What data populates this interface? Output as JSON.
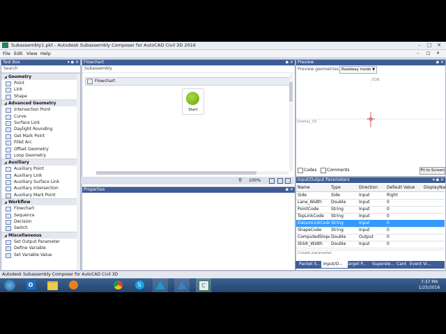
{
  "window": {
    "title": "Subassembly1.pkt - Autodesk Subassembly Composer for AutoCAD Civil 3D 2016"
  },
  "menu": [
    "File",
    "Edit",
    "View",
    "Help"
  ],
  "toolbox": {
    "title": "Tool Box",
    "search_placeholder": "Search",
    "categories": [
      {
        "name": "Geometry",
        "items": [
          "Point",
          "Link",
          "Shape"
        ]
      },
      {
        "name": "Advanced Geometry",
        "items": [
          "Intersection Point",
          "Curve",
          "Surface Link",
          "Daylight Rounding",
          "Get Mark Point",
          "Fillet Arc",
          "Offset Geometry",
          "Loop Geometry"
        ]
      },
      {
        "name": "Auxiliary",
        "items": [
          "Auxiliary Point",
          "Auxiliary Link",
          "Auxiliary Surface Link",
          "Auxiliary Intersection",
          "Auxiliary Mark Point"
        ]
      },
      {
        "name": "Workflow",
        "items": [
          "Flowchart",
          "Sequence",
          "Decision",
          "Switch"
        ]
      },
      {
        "name": "Miscellaneous",
        "items": [
          "Set Output Parameter",
          "Define Variable",
          "Set Variable Value"
        ]
      }
    ]
  },
  "flowchart": {
    "panel_title": "Flowchart",
    "breadcrumb": "Subassembly",
    "container_label": "Flowchart",
    "start_label": "Start",
    "zoom": "100%"
  },
  "properties": {
    "title": "Properties"
  },
  "preview": {
    "title": "Preview",
    "label": "Preview geometries in",
    "mode": "Roadway mode",
    "marker_top": "EOB",
    "marker_side": "Overlay_03",
    "codes_label": "Codes",
    "comments_label": "Comments",
    "fit_button": "Fit to Screen"
  },
  "params": {
    "title": "Input/Output Parameters",
    "columns": [
      "Name",
      "Type",
      "Direction",
      "Default Value",
      "DisplayName"
    ],
    "rows": [
      [
        "Side",
        "Side",
        "Input",
        "Right",
        ""
      ],
      [
        "Lane_Width",
        "Double",
        "Input",
        "0",
        ""
      ],
      [
        "PointCode",
        "String",
        "Input",
        "0",
        ""
      ],
      [
        "TopLinkCode",
        "String",
        "Input",
        "0",
        ""
      ],
      [
        "DatumLinkCode",
        "String",
        "Input",
        "0",
        ""
      ],
      [
        "ShapeCode",
        "String",
        "Input",
        "0",
        ""
      ],
      [
        "ComputedSlope",
        "Double",
        "Output",
        "0",
        ""
      ],
      [
        "Shldr_Width",
        "Double",
        "Input",
        "0",
        ""
      ]
    ],
    "selected_row": 4,
    "create_placeholder": "Create parameter",
    "tabs": [
      "Packet S...",
      "Input/O...",
      "Target P...",
      "Superele...",
      "Cant",
      "Event Vi..."
    ],
    "active_tab": 1
  },
  "status": {
    "text": "Autodesk Subassembly Composer for AutoCAD Civil 3D"
  },
  "taskbar": {
    "icons": [
      "start-orb-icon",
      "outlook-icon",
      "file-explorer-icon",
      "media-player-icon",
      "chrome-icon",
      "skype-icon",
      "autocad-civil-icon",
      "autocad-icon",
      "subassembly-composer-icon"
    ],
    "time": "7:37 PM",
    "date": "1/25/2016"
  },
  "colors": {
    "header": "#3e5d97",
    "selection": "#3399ff",
    "start_node": "#7fbf1f",
    "marker": "#d0304a",
    "taskbar": "#2b4f7a"
  }
}
